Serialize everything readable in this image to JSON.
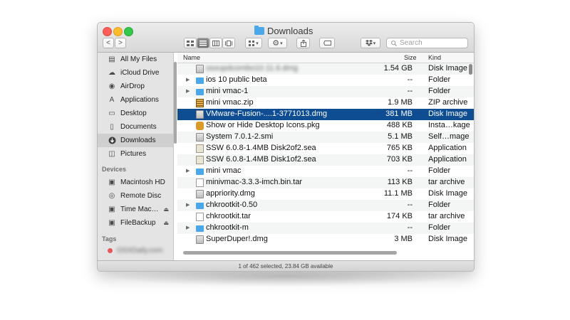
{
  "window": {
    "title": "Downloads",
    "status": "1 of 462 selected, 23.84 GB available"
  },
  "toolbar": {
    "back": "<",
    "forward": ">",
    "search_placeholder": "Search",
    "view_modes": [
      "icon-view",
      "list-view",
      "column-view",
      "cover-flow"
    ],
    "arrange_label": "▾",
    "action_label": "▾",
    "dropbox_label": "▾"
  },
  "sidebar": {
    "favorites": [
      {
        "label": "All My Files",
        "icon": "all-files-icon"
      },
      {
        "label": "iCloud Drive",
        "icon": "cloud-icon"
      },
      {
        "label": "AirDrop",
        "icon": "airdrop-icon"
      },
      {
        "label": "Applications",
        "icon": "applications-icon"
      },
      {
        "label": "Desktop",
        "icon": "desktop-icon"
      },
      {
        "label": "Documents",
        "icon": "documents-icon"
      },
      {
        "label": "Downloads",
        "icon": "downloads-icon"
      },
      {
        "label": "Pictures",
        "icon": "pictures-icon"
      }
    ],
    "devices_heading": "Devices",
    "devices": [
      {
        "label": "Macintosh HD",
        "icon": "disk-icon"
      },
      {
        "label": "Remote Disc",
        "icon": "disc-icon"
      },
      {
        "label": "Time Mac…",
        "icon": "disk-icon",
        "eject": "⏏"
      },
      {
        "label": "FileBackup",
        "icon": "disk-icon",
        "eject": "⏏"
      }
    ],
    "tags_heading": "Tags",
    "tag_label": "OSXDaily.com"
  },
  "columns": {
    "name": "Name",
    "size": "Size",
    "kind": "Kind"
  },
  "files": [
    {
      "name": "osxupdcombo10.11.6.dmg",
      "size": "1.54 GB",
      "kind": "Disk Image",
      "type": "dmg",
      "blurred": true
    },
    {
      "name": "ios 10 public beta",
      "size": "--",
      "kind": "Folder",
      "type": "folder",
      "expandable": true
    },
    {
      "name": "mini vmac-1",
      "size": "--",
      "kind": "Folder",
      "type": "folder",
      "expandable": true
    },
    {
      "name": "mini vmac.zip",
      "size": "1.9 MB",
      "kind": "ZIP archive",
      "type": "zip"
    },
    {
      "name": "VMware-Fusion-....1-3771013.dmg",
      "size": "381 MB",
      "kind": "Disk Image",
      "type": "dmg",
      "selected": true
    },
    {
      "name": "Show or Hide Desktop Icons.pkg",
      "size": "488 KB",
      "kind": "Insta…kage",
      "type": "pkg"
    },
    {
      "name": "System 7.0.1-2.smi",
      "size": "5.1 MB",
      "kind": "Self…mage",
      "type": "dmg"
    },
    {
      "name": "SSW 6.0.8-1.4MB Disk2of2.sea",
      "size": "765 KB",
      "kind": "Application",
      "type": "sea"
    },
    {
      "name": "SSW 6.0.8-1.4MB Disk1of2.sea",
      "size": "703 KB",
      "kind": "Application",
      "type": "sea"
    },
    {
      "name": "mini vmac",
      "size": "--",
      "kind": "Folder",
      "type": "folder",
      "expandable": true
    },
    {
      "name": "minivmac-3.3.3-imch.bin.tar",
      "size": "113 KB",
      "kind": "tar archive",
      "type": "doc"
    },
    {
      "name": "appriority.dmg",
      "size": "11.1 MB",
      "kind": "Disk Image",
      "type": "dmg"
    },
    {
      "name": "chkrootkit-0.50",
      "size": "--",
      "kind": "Folder",
      "type": "folder",
      "expandable": true
    },
    {
      "name": "chkrootkit.tar",
      "size": "174 KB",
      "kind": "tar archive",
      "type": "doc"
    },
    {
      "name": "chkrootkit-m",
      "size": "--",
      "kind": "Folder",
      "type": "folder",
      "expandable": true
    },
    {
      "name": "SuperDuper!.dmg",
      "size": "3 MB",
      "kind": "Disk Image",
      "type": "dmg"
    }
  ]
}
